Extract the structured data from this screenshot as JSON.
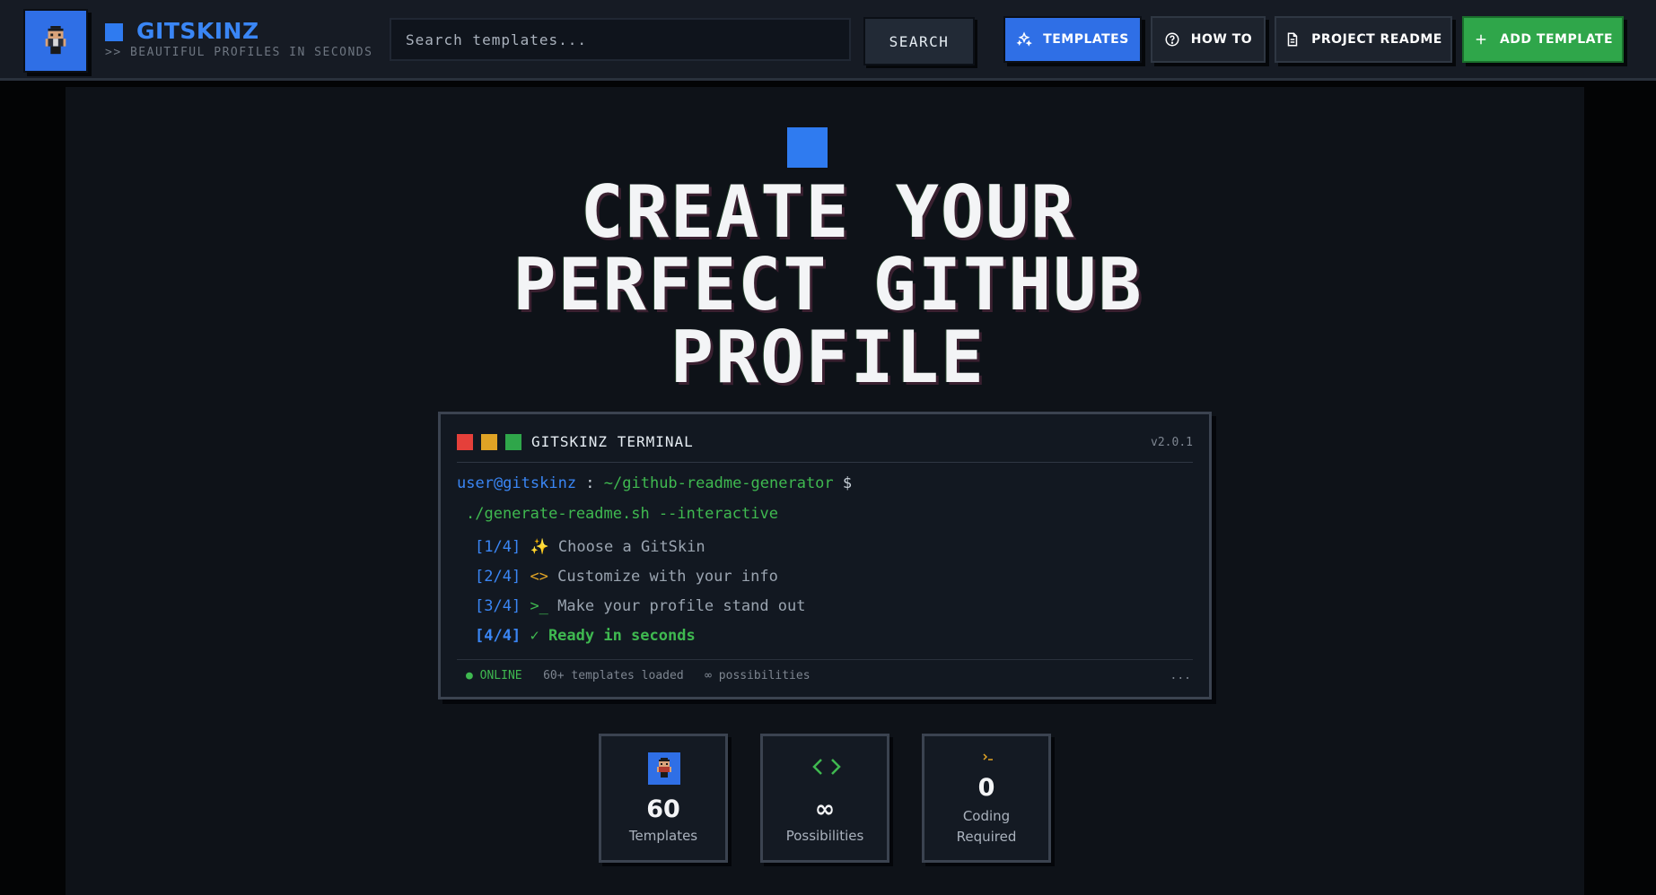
{
  "header": {
    "brand_name": "GITSKINZ",
    "tagline": ">> BEAUTIFUL PROFILES IN SECONDS",
    "search_placeholder": "Search templates...",
    "search_label": "SEARCH",
    "nav": [
      {
        "label": "TEMPLATES",
        "icon": "sparkles-icon"
      },
      {
        "label": "HOW TO",
        "icon": "help-circle-icon"
      },
      {
        "label": "PROJECT README",
        "icon": "document-icon"
      },
      {
        "label": "ADD TEMPLATE",
        "icon": "plus-icon"
      }
    ]
  },
  "hero": {
    "title_line1": "CREATE YOUR",
    "title_line2": "PERFECT GITHUB",
    "title_line3": "PROFILE"
  },
  "terminal": {
    "title": "GITSKINZ TERMINAL",
    "version": "v2.0.1",
    "prompt_user": "user@gitskinz",
    "prompt_sep": " : ",
    "prompt_path": "~/github-readme-generator",
    "prompt_symbol": " $",
    "command": "./generate-readme.sh --interactive",
    "steps": [
      {
        "num": "[1/4]",
        "icon": "✨",
        "text": "Choose a GitSkin"
      },
      {
        "num": "[2/4]",
        "icon": "<>",
        "text": "Customize with your info"
      },
      {
        "num": "[3/4]",
        "icon": ">_",
        "text": "Make your profile stand out"
      },
      {
        "num": "[4/4]",
        "icon": "✓",
        "text": "Ready in seconds"
      }
    ],
    "footer": {
      "status": "● ONLINE",
      "templates": "60+ templates loaded",
      "possibilities": "∞ possibilities",
      "dots": "..."
    },
    "dot_colors": [
      "#e5403a",
      "#e0a325",
      "#2fa64a"
    ]
  },
  "stats": [
    {
      "value": "60",
      "label": "Templates",
      "icon": "avatar-icon"
    },
    {
      "value": "∞",
      "label": "Possibilities",
      "icon": "code-icon"
    },
    {
      "value": "0",
      "label": "Coding Required",
      "icon": "terminal-icon"
    }
  ],
  "colors": {
    "accent_blue": "#2f6fe6",
    "accent_green": "#2fa64a",
    "background": "#0e1218"
  }
}
